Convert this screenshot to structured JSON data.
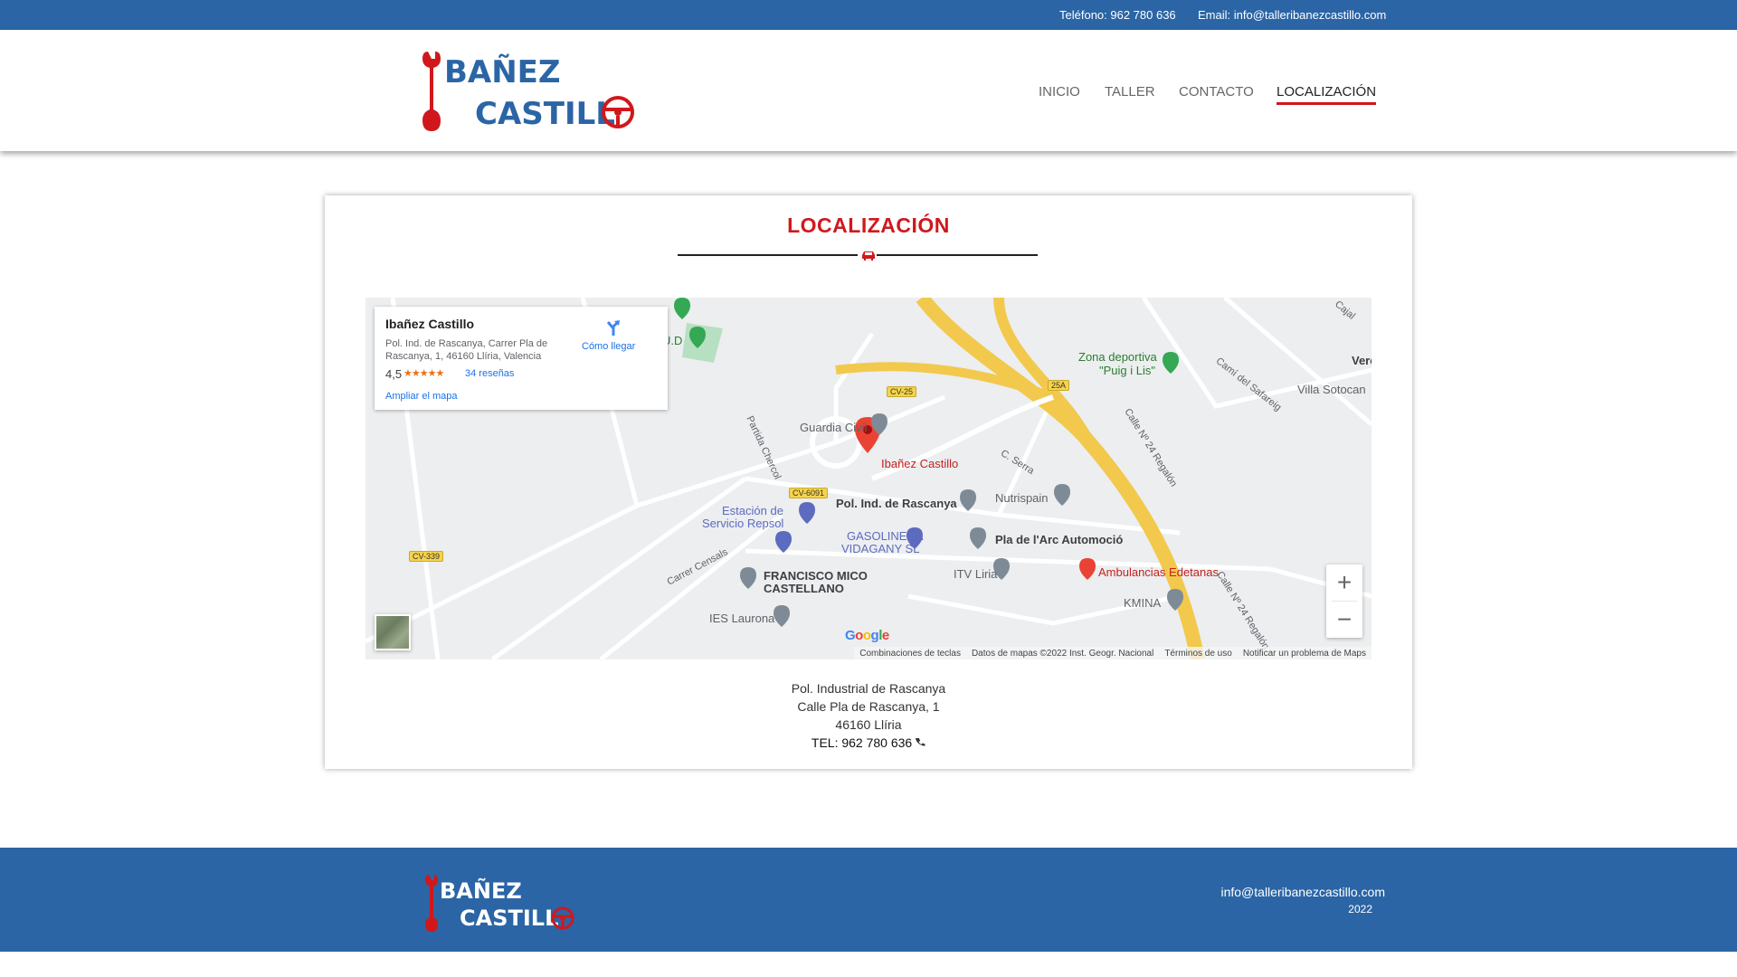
{
  "topbar": {
    "phone": "Teléfono: 962 780 636",
    "email": "Email: info@talleribanezcastillo.com"
  },
  "brand": {
    "line1": "BAÑEZ",
    "line2": "CASTILL",
    "accent": "#d0181c",
    "primary": "#2b65a5"
  },
  "nav": [
    {
      "label": "INICIO",
      "active": false
    },
    {
      "label": "TALLER",
      "active": false
    },
    {
      "label": "CONTACTO",
      "active": false
    },
    {
      "label": "LOCALIZACIÓN",
      "active": true
    }
  ],
  "section": {
    "title": "LOCALIZACIÓN",
    "divider_icon": "car-icon"
  },
  "map": {
    "infobox": {
      "name": "Ibañez Castillo",
      "address": "Pol. Ind. de Rascanya, Carrer Pla de Rascanya, 1, 46160 Llíria, Valencia",
      "rating": "4,5",
      "stars": "★★★★★",
      "reviews": "34 reseñas",
      "directions": "Cómo llegar",
      "enlarge": "Ampliar el mapa"
    },
    "labels": {
      "ud": "U.D",
      "zona1": "Zona deportiva",
      "zona2": "\"Puig i Lis\"",
      "guardia": "Guardia Civil",
      "place": "Ibañez Castillo",
      "cserra": "C. Serra",
      "poligono": "Pol. Ind. de Rascanya",
      "nutrispain": "Nutrispain",
      "estacion1": "Estación de",
      "estacion2": "Servicio Repsol",
      "gasolinera1": "GASOLINERA",
      "gasolinera2": "VIDAGANY SL",
      "pla": "Pla de l'Arc Automoció",
      "itv": "ITV Liria",
      "ambulancias": "Ambulancias Edetanas",
      "kmina": "KMINA",
      "francisco1": "FRANCISCO MICO",
      "francisco2": "CASTELLANO",
      "ies": "IES Laurona",
      "carrer": "Carrer Censals",
      "partida": "Partida Chercol",
      "calle1": "Calle Nº 24 Regalón",
      "calle2": "Calle Nº 24 Regalón",
      "cami": "Camí del Safareig",
      "villa": "Villa Sotocan",
      "vere": "Vere",
      "cajal": "Cajal"
    },
    "shields": {
      "cv25": "CV-25",
      "25a": "25A",
      "cv6091": "CV-6091",
      "cv339": "CV-339"
    },
    "google": "Google",
    "attribution": [
      "Combinaciones de teclas",
      "Datos de mapas ©2022 Inst. Geogr. Nacional",
      "Términos de uso",
      "Notificar un problema de Maps"
    ],
    "zoom_in": "+",
    "zoom_out": "−"
  },
  "address": {
    "line1": "Pol. Industrial de Rascanya",
    "line2": "Calle Pla de Rascanya, 1",
    "line3": "46160 Llíria",
    "tel": "TEL: 962 780 636"
  },
  "footer": {
    "email": "info@talleribanezcastillo.com",
    "year": "2022"
  }
}
